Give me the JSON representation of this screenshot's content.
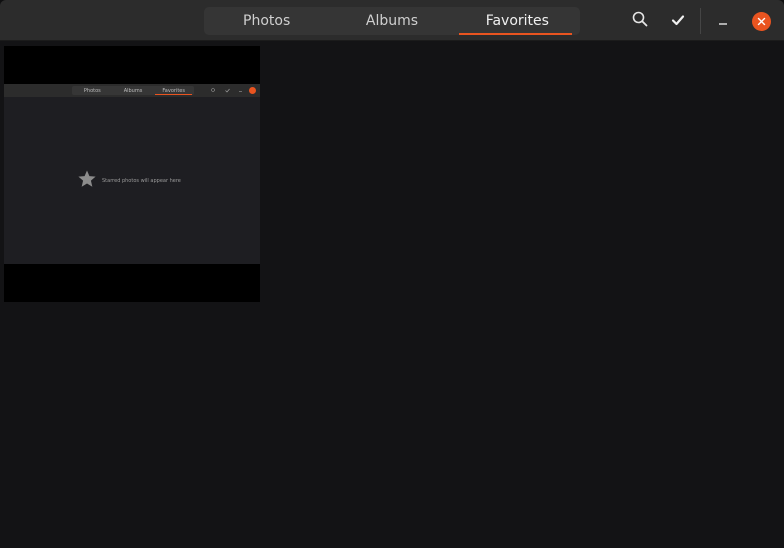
{
  "header": {
    "tabs": [
      {
        "label": "Photos",
        "active": false
      },
      {
        "label": "Albums",
        "active": false
      },
      {
        "label": "Favorites",
        "active": true
      }
    ],
    "icons": {
      "search": "search-icon",
      "select": "checkmark-icon",
      "minimize": "minimize-icon",
      "close": "close-icon"
    }
  },
  "content": {
    "items": [
      {
        "type": "screenshot-thumbnail",
        "starred": true,
        "thumbnail": {
          "tabs": [
            {
              "label": "Photos"
            },
            {
              "label": "Albums"
            },
            {
              "label": "Favorites"
            }
          ],
          "empty_message": "Starred photos will appear here"
        }
      }
    ]
  },
  "colors": {
    "accent": "#e95420",
    "headerbar": "#2c2c2c",
    "background": "#131315"
  }
}
